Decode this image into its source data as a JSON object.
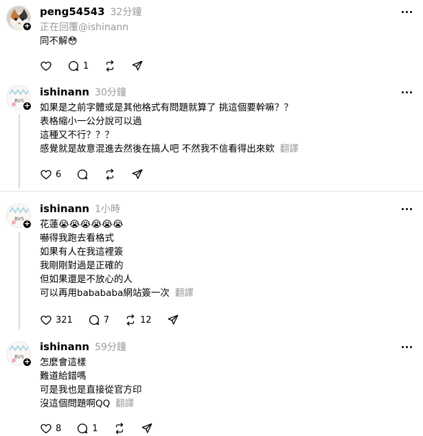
{
  "posts": [
    {
      "username": "peng54543",
      "time": "32分鐘",
      "replying": "正在回覆@ishinann",
      "lines": [
        "同不解😳"
      ],
      "translate": "",
      "likes": "",
      "comments": "1",
      "reposts": ""
    },
    {
      "username": "ishinann",
      "time": "30分鐘",
      "lines": [
        "如果是之前字體或是其他格式有問題就算了 挑這個要幹嘛？？",
        "表格縮小一公分說可以過",
        "這種又不行？？？",
        "感覺就是故意混進去然後在搞人吧 不然我不信看得出來欸"
      ],
      "translate": "翻譯",
      "likes": "6",
      "comments": "",
      "reposts": ""
    },
    {
      "username": "ishinann",
      "time": "1小時",
      "lines": [
        "花蓮😭😭😭😭😭😭",
        "嚇得我跑去看格式",
        "如果有人在我這裡簽",
        "我剛剛對過是正確的",
        "但如果還是不放心的人",
        "可以再用babababa網站簽一次"
      ],
      "translate": "翻譯",
      "likes": "321",
      "comments": "7",
      "reposts": "12"
    },
    {
      "username": "ishinann",
      "time": "59分鐘",
      "lines": [
        "怎麼會這樣",
        "難道給錯嗎",
        "可是我也是直接從官方印",
        "沒這個問題啊QQ"
      ],
      "translate": "翻譯",
      "likes": "8",
      "comments": "1",
      "reposts": ""
    }
  ]
}
